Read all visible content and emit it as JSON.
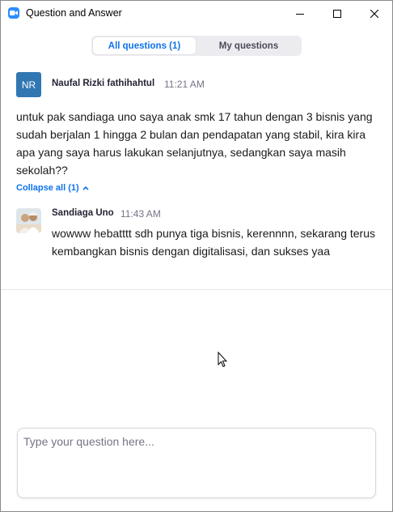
{
  "window": {
    "title": "Question and Answer",
    "icon": "zoom-video-icon"
  },
  "tabs": [
    {
      "label": "All questions (1)",
      "selected": true
    },
    {
      "label": "My questions",
      "selected": false
    }
  ],
  "question": {
    "avatar_initials": "NR",
    "avatar_color": "#3177b2",
    "author": "Naufal Rizki fathihahtul",
    "time": "11:21 AM",
    "text": "untuk pak sandiaga uno saya anak smk 17 tahun dengan 3 bisnis yang sudah berjalan 1 hingga 2 bulan dan pendapatan yang stabil, kira kira apa yang saya harus lakukan selanjutnya, sedangkan saya masih sekolah??",
    "collapse_label": "Collapse all (1)"
  },
  "answer": {
    "author": "Sandiaga Uno",
    "time": "11:43 AM",
    "text": "wowww hebatttt sdh punya tiga bisnis, kerennnn, sekarang terus kembangkan bisnis dengan digitalisasi, dan sukses yaa"
  },
  "compose": {
    "placeholder": "Type your question here..."
  },
  "colors": {
    "accent": "#0e72ed",
    "muted_text": "#747487"
  }
}
